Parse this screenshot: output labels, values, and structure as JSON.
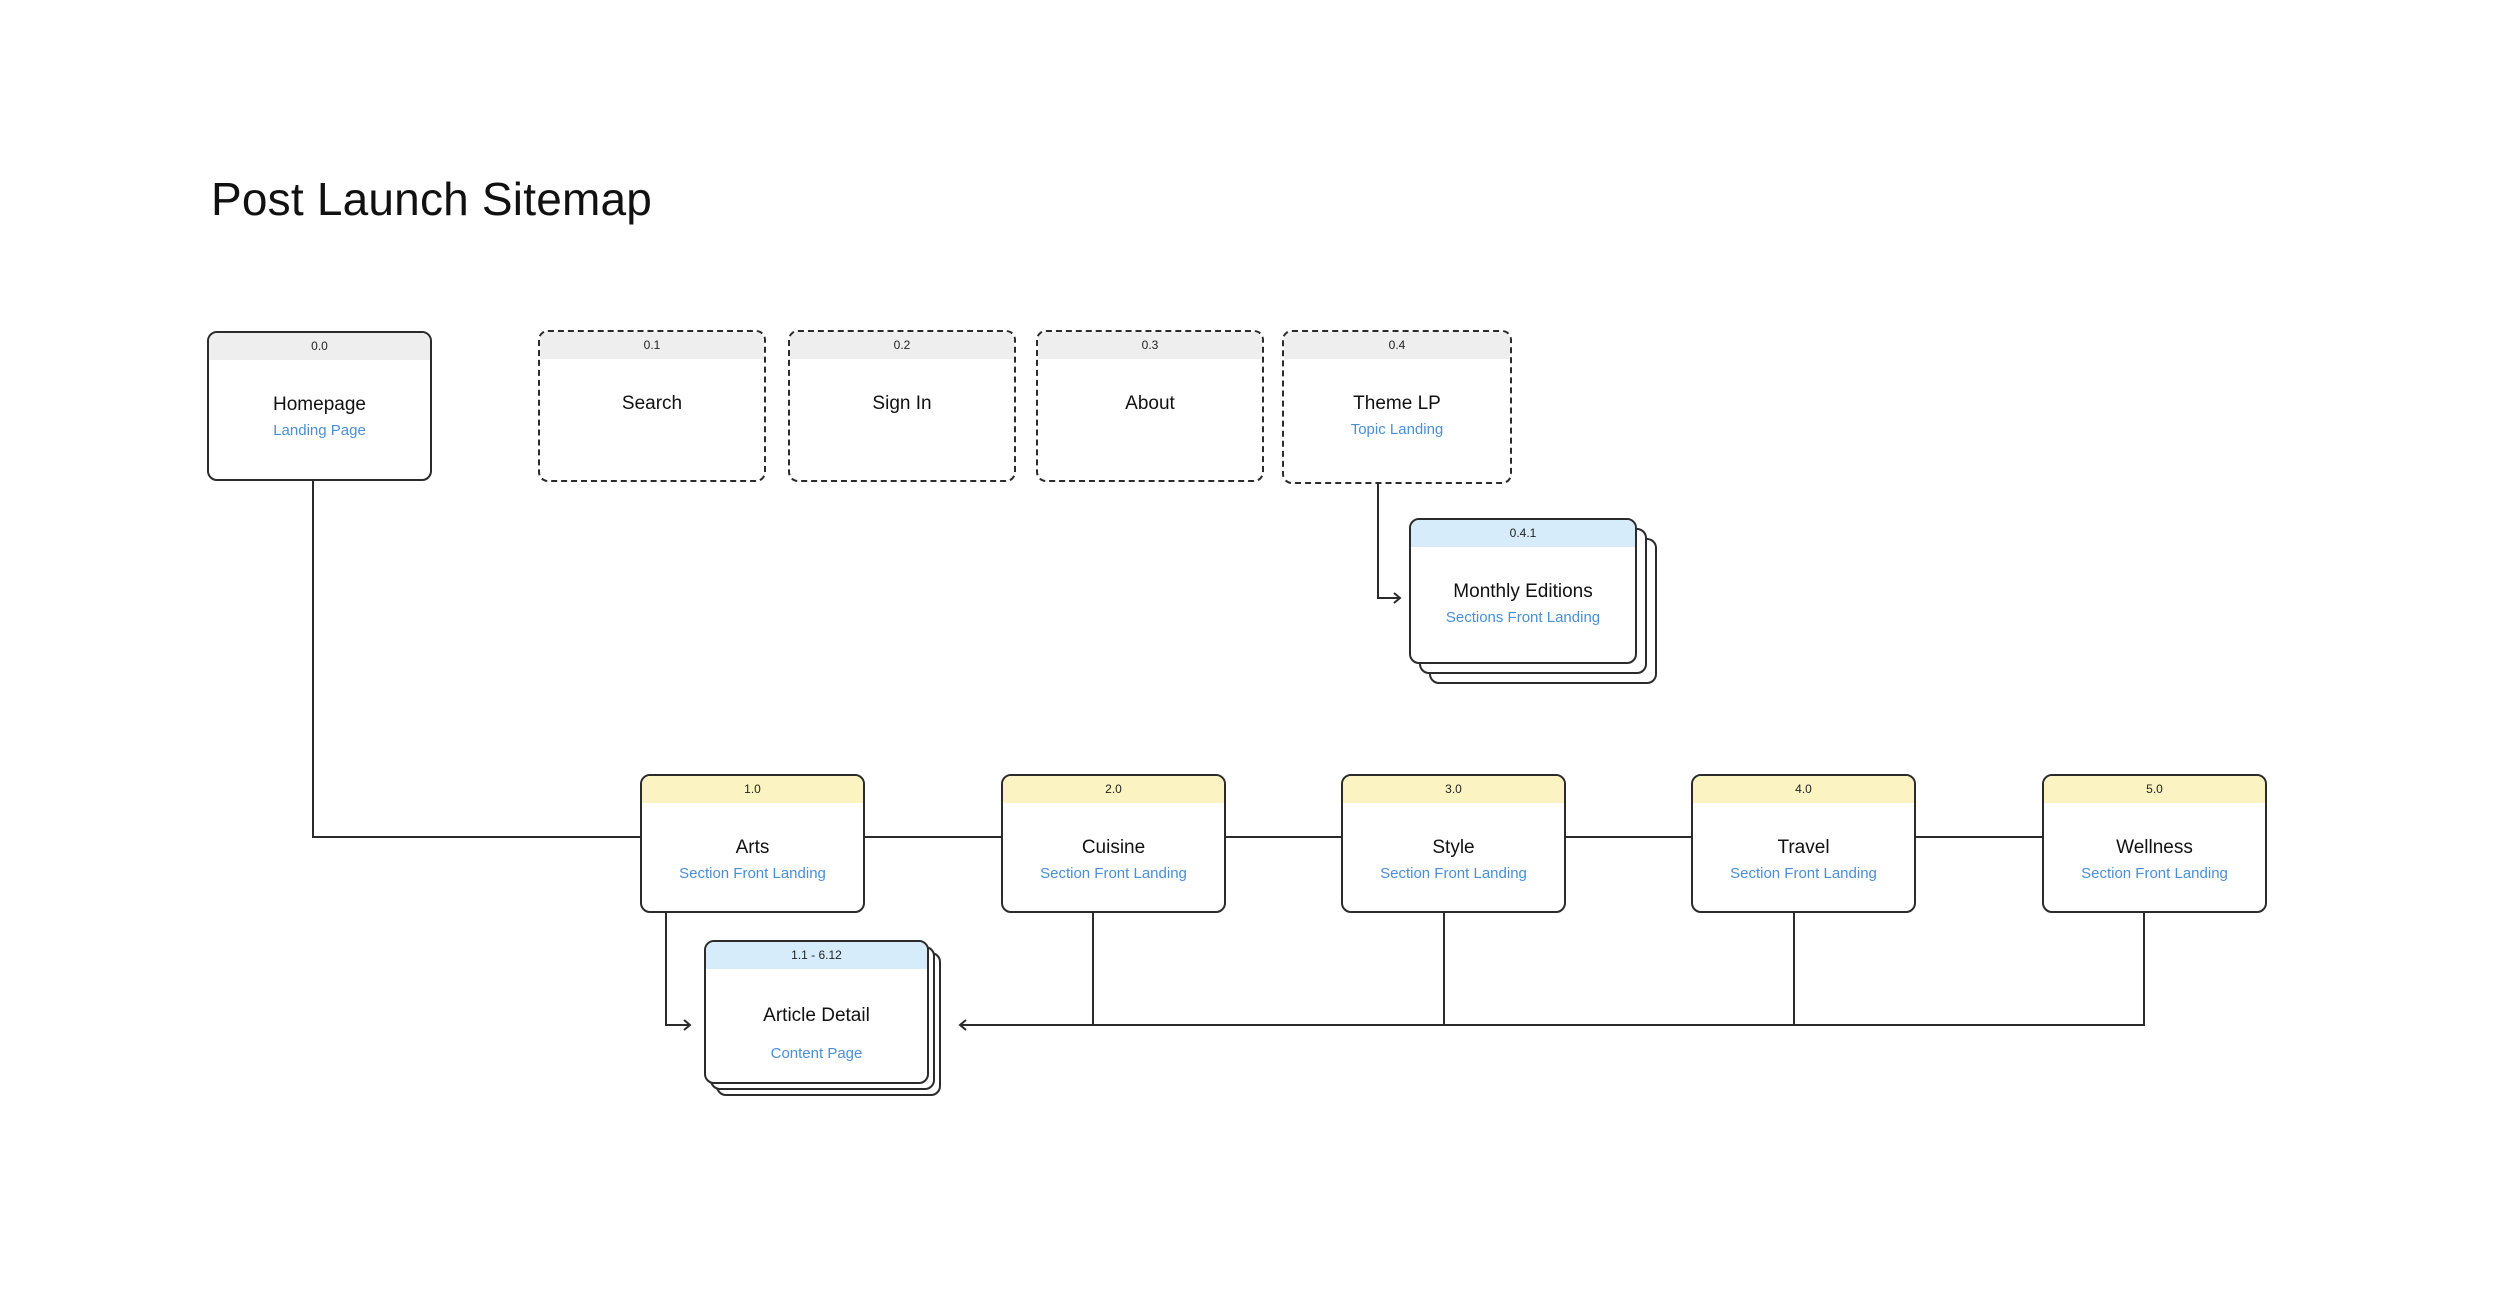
{
  "title": "Post Launch Sitemap",
  "colors": {
    "line": "#2b2b2b",
    "subtitle": "#4a8fd4",
    "header_utility": "#eeeeee",
    "header_section": "#fbf4c2",
    "header_template": "#d6ecfa"
  },
  "nodes": {
    "homepage": {
      "id": "0.0",
      "name": "Homepage",
      "subtitle": "Landing Page"
    },
    "search": {
      "id": "0.1",
      "name": "Search"
    },
    "sign_in": {
      "id": "0.2",
      "name": "Sign In"
    },
    "about": {
      "id": "0.3",
      "name": "About"
    },
    "theme_lp": {
      "id": "0.4",
      "name": "Theme LP",
      "subtitle": "Topic Landing"
    },
    "monthly_editions": {
      "id": "0.4.1",
      "name": "Monthly Editions",
      "subtitle": "Sections Front Landing"
    },
    "arts": {
      "id": "1.0",
      "name": "Arts",
      "subtitle": "Section Front Landing"
    },
    "cuisine": {
      "id": "2.0",
      "name": "Cuisine",
      "subtitle": "Section Front Landing"
    },
    "style": {
      "id": "3.0",
      "name": "Style",
      "subtitle": "Section Front Landing"
    },
    "travel": {
      "id": "4.0",
      "name": "Travel",
      "subtitle": "Section Front Landing"
    },
    "wellness": {
      "id": "5.0",
      "name": "Wellness",
      "subtitle": "Section Front Landing"
    },
    "article_detail": {
      "id": "1.1 - 6.12",
      "name": "Article Detail",
      "subtitle": "Content Page"
    }
  }
}
